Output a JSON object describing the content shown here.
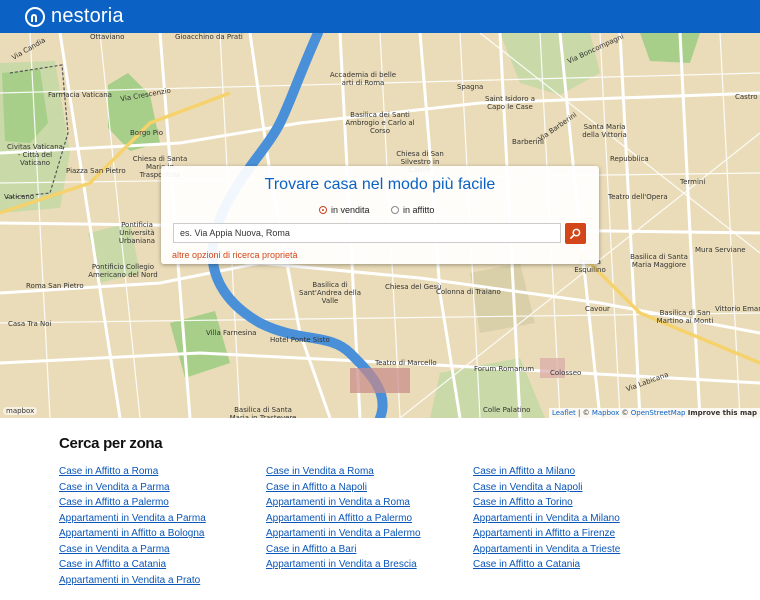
{
  "brand": {
    "name": "nestoria"
  },
  "map": {
    "labels": [
      {
        "id": "ottaviano",
        "text": "Ottaviano"
      },
      {
        "id": "gioacchino",
        "text": "Gioacchino da Prati"
      },
      {
        "id": "accademia",
        "text": "Accademia di belle arti di Roma"
      },
      {
        "id": "spagna",
        "text": "Spagna"
      },
      {
        "id": "basilica-ambrogio",
        "text": "Basilica dei Santi Ambrogio e Carlo al Corso"
      },
      {
        "id": "isidoro",
        "text": "Saint Isidoro a Capo le Case"
      },
      {
        "id": "barberini",
        "text": "Barberini"
      },
      {
        "id": "santamaria-vittoria",
        "text": "Santa Maria della Vittoria"
      },
      {
        "id": "repubblica",
        "text": "Repubblica"
      },
      {
        "id": "castro",
        "text": "Castro P"
      },
      {
        "id": "termini",
        "text": "Termini"
      },
      {
        "id": "farmacia",
        "text": "Farmacia Vaticana"
      },
      {
        "id": "civitas",
        "text": "Civitas Vaticana - Città del Vaticano"
      },
      {
        "id": "borgo",
        "text": "Borgo Pio"
      },
      {
        "id": "piazza-sanpietro",
        "text": "Piazza San Pietro"
      },
      {
        "id": "chiesa-santamaria-tr",
        "text": "Chiesa di Santa Maria in Traspontina"
      },
      {
        "id": "chiesa-silvestro",
        "text": "Chiesa di San Silvestro in Capite"
      },
      {
        "id": "pontificia",
        "text": "Pontificia Università Urbaniana"
      },
      {
        "id": "collegio",
        "text": "Pontificio Collegio Americano del Nord"
      },
      {
        "id": "roma-sanpietro",
        "text": "Roma San Pietro"
      },
      {
        "id": "casa-tranoi",
        "text": "Casa Tra Noi"
      },
      {
        "id": "basilica-andrea",
        "text": "Basilica di Sant'Andrea della Valle"
      },
      {
        "id": "gesu",
        "text": "Chiesa del Gesù"
      },
      {
        "id": "colonna",
        "text": "Colonna di Traiano"
      },
      {
        "id": "teatro-opera",
        "text": "Teatro dell'Opera"
      },
      {
        "id": "mura-serviane",
        "text": "Mura Serviane"
      },
      {
        "id": "basilica-santamaria-magg",
        "text": "Basilica di Santa Maria Maggiore"
      },
      {
        "id": "esquilino",
        "text": "Piazza Esquilino"
      },
      {
        "id": "cavour",
        "text": "Cavour"
      },
      {
        "id": "basilica-martino",
        "text": "Basilica di San Martino ai Monti"
      },
      {
        "id": "vittorio",
        "text": "Vittorio Eman"
      },
      {
        "id": "villa-farnesina",
        "text": "Villa Farnesina"
      },
      {
        "id": "hotel-ponte",
        "text": "Hotel Ponte Sisto"
      },
      {
        "id": "teatro-marcello",
        "text": "Teatro di Marcello"
      },
      {
        "id": "forum",
        "text": "Forum Romanum"
      },
      {
        "id": "colosseo",
        "text": "Colosseo"
      },
      {
        "id": "colle-palatino",
        "text": "Colle Palatino"
      },
      {
        "id": "basilica-trastevere",
        "text": "Basilica di Santa Maria in Trastevere"
      },
      {
        "id": "vaticano-st",
        "text": "Vaticano"
      },
      {
        "id": "via-crescenzio",
        "text": "Via Crescenzio"
      },
      {
        "id": "via-barberini",
        "text": "Via Barberini"
      },
      {
        "id": "via-labicana",
        "text": "Via Labicana"
      },
      {
        "id": "via-boncompagni",
        "text": "Via Boncompagni"
      },
      {
        "id": "via-candia",
        "text": "Via Candia"
      }
    ],
    "attribution": {
      "leaflet": "Leaflet",
      "sep1": " | © ",
      "mapbox": "Mapbox",
      "sep2": " © ",
      "osm": "OpenStreetMap",
      "improve": "Improve this map"
    },
    "mapbox_logo": "mapbox"
  },
  "search": {
    "title": "Trovare casa nel modo più facile",
    "options": [
      {
        "label": "in vendita",
        "selected": true
      },
      {
        "label": "in affitto",
        "selected": false
      }
    ],
    "placeholder": "es. Via Appia Nuova, Roma",
    "more_link": "altre opzioni di ricerca proprietà"
  },
  "zones": {
    "title": "Cerca per zona",
    "columns": [
      [
        "Case in Affitto a Roma",
        "Case in Vendita a Parma",
        "Case in Affitto a Palermo",
        "Appartamenti in Vendita a Parma",
        "Appartamenti in Affitto a Bologna",
        "Case in Vendita a Parma",
        "Case in Affitto a Catania",
        "Appartamenti in Vendita a Prato"
      ],
      [
        "Case in Vendita a Roma",
        "Case in Affitto a Napoli",
        "Appartamenti in Vendita a Roma",
        "Appartamenti in Affitto a Palermo",
        "Appartamenti in Vendita a Palermo",
        "Case in Affitto a Bari",
        "Appartamenti in Vendita a Brescia"
      ],
      [
        "Case in Affitto a Milano",
        "Case in Vendita a Napoli",
        "Case in Affitto a Torino",
        "Appartamenti in Vendita a Milano",
        "Appartamenti in Affitto a Firenze",
        "Appartamenti in Vendita a Trieste",
        "Case in Affitto a Catania"
      ]
    ]
  },
  "colors": {
    "brand_blue": "#0b62c4",
    "accent_orange": "#d2461a",
    "map_bg": "#eadcb8",
    "river": "#4a90d9",
    "park": "#a8cf8a"
  }
}
